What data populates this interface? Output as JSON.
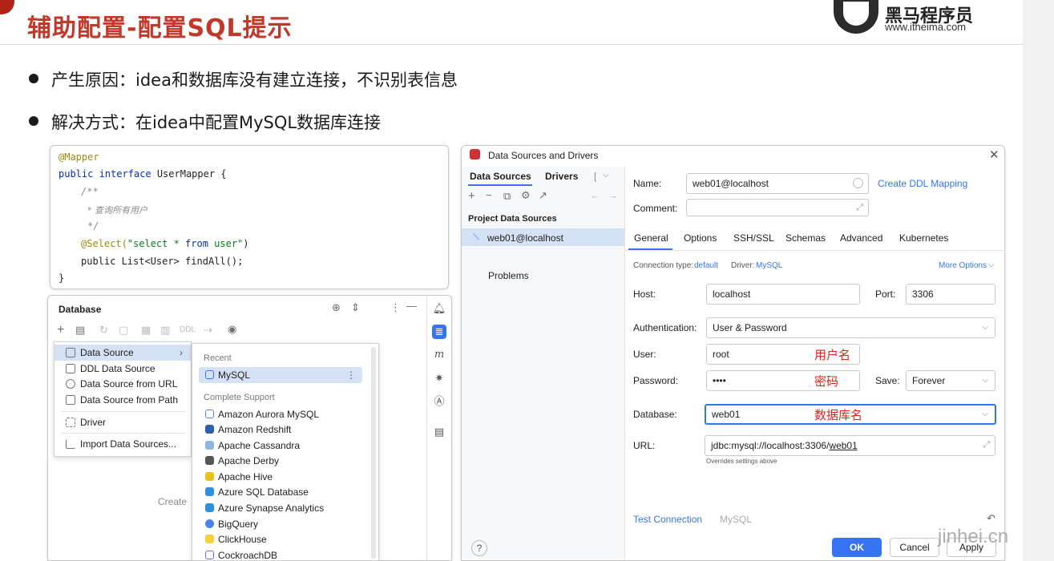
{
  "slide": {
    "title": "辅助配置-配置SQL提示",
    "logo_name": "黑马程序员",
    "logo_url": "www.itheima.com",
    "bullets": [
      "产生原因：idea和数据库没有建立连接，不识别表信息",
      "解决方式：在idea中配置MySQL数据库连接"
    ]
  },
  "code": {
    "l1": "@Mapper",
    "l2a": "public interface ",
    "l2b": "UserMapper {",
    "l3": "/**",
    "l4": "* 查询所有用户",
    "l5": "*/",
    "l6a": "@Select(",
    "l6b": "\"select * ",
    "l6c": "from ",
    "l6d": "user\"",
    "l6e": ")",
    "l7": "public List<User> findAll();",
    "l8": "}"
  },
  "database": {
    "title": "Database",
    "toolbar_ddl": "DDL",
    "create_hint": "Create",
    "menu": [
      "Data Source",
      "DDL Data Source",
      "Data Source from URL",
      "Data Source from Path",
      "Driver",
      "Import Data Sources..."
    ],
    "recent_header": "Recent",
    "recent": [
      "MySQL"
    ],
    "complete_header": "Complete Support",
    "complete": [
      "Amazon Aurora MySQL",
      "Amazon Redshift",
      "Apache Cassandra",
      "Apache Derby",
      "Apache Hive",
      "Azure SQL Database",
      "Azure Synapse Analytics",
      "BigQuery",
      "ClickHouse",
      "CockroachDB"
    ],
    "side_icons": [
      "bell-icon",
      "database-icon",
      "m-icon",
      "gear-icon",
      "ai-icon",
      "list-icon"
    ]
  },
  "dialog": {
    "title": "Data Sources and Drivers",
    "left_tabs": [
      "Data Sources",
      "Drivers",
      "["
    ],
    "project_header": "Project Data Sources",
    "datasource_item": "web01@localhost",
    "problems": "Problems",
    "name_label": "Name:",
    "name_value": "web01@localhost",
    "create_ddl": "Create DDL Mapping",
    "comment_label": "Comment:",
    "tabs": [
      "General",
      "Options",
      "SSH/SSL",
      "Schemas",
      "Advanced",
      "Kubernetes"
    ],
    "conn_type_label": "Connection type:",
    "conn_type_value": "default",
    "driver_label": "Driver:",
    "driver_value": "MySQL",
    "more_options": "More Options",
    "host_label": "Host:",
    "host_value": "localhost",
    "port_label": "Port:",
    "port_value": "3306",
    "auth_label": "Authentication:",
    "auth_value": "User & Password",
    "user_label": "User:",
    "user_value": "root",
    "user_note": "用户名",
    "password_label": "Password:",
    "password_value": "••••",
    "password_note": "密码",
    "save_label": "Save:",
    "save_value": "Forever",
    "database_label": "Database:",
    "database_value": "web01",
    "database_note": "数据库名",
    "url_label": "URL:",
    "url_prefix": "jdbc:mysql://localhost:3306/",
    "url_db": "web01",
    "url_hint": "Overrides settings above",
    "test_connection": "Test Connection",
    "test_driver": "MySQL",
    "help": "?",
    "ok": "OK",
    "cancel": "Cancel",
    "apply": "Apply"
  },
  "watermark": "jinhei.cn",
  "colors": {
    "title_red": "#c0392b",
    "note_red": "#e2231a",
    "accent_blue": "#3574f0",
    "selection": "#d5e1f5"
  }
}
